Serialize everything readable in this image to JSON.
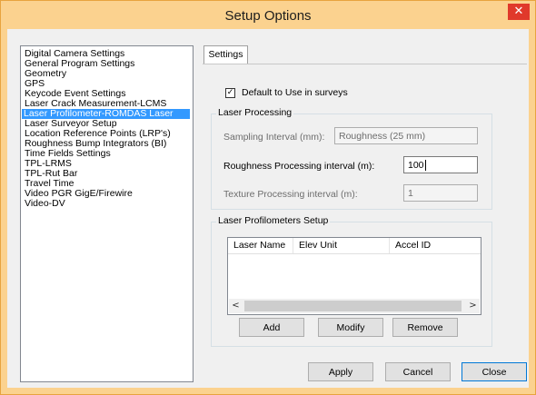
{
  "window": {
    "title": "Setup Options",
    "close_glyph": "✕"
  },
  "categories": [
    {
      "label": "Digital Camera Settings",
      "selected": false
    },
    {
      "label": "General Program Settings",
      "selected": false
    },
    {
      "label": "Geometry",
      "selected": false
    },
    {
      "label": "GPS",
      "selected": false
    },
    {
      "label": "Keycode Event Settings",
      "selected": false
    },
    {
      "label": "Laser Crack Measurement-LCMS",
      "selected": false
    },
    {
      "label": "Laser Profilometer-ROMDAS Laser",
      "selected": true
    },
    {
      "label": "Laser Surveyor Setup",
      "selected": false
    },
    {
      "label": "Location Reference Points (LRP's)",
      "selected": false
    },
    {
      "label": "Roughness Bump Integrators (BI)",
      "selected": false
    },
    {
      "label": "Time Fields Settings",
      "selected": false
    },
    {
      "label": "TPL-LRMS",
      "selected": false
    },
    {
      "label": "TPL-Rut Bar",
      "selected": false
    },
    {
      "label": "Travel Time",
      "selected": false
    },
    {
      "label": "Video PGR GigE/Firewire",
      "selected": false
    },
    {
      "label": "Video-DV",
      "selected": false
    }
  ],
  "tab": {
    "label": "Settings"
  },
  "default_checkbox": {
    "label": "Default to Use in surveys",
    "checked": true,
    "glyph": "✓"
  },
  "laser_processing": {
    "title": "Laser Processing",
    "sampling": {
      "label": "Sampling Interval (mm):",
      "value": "Roughness (25 mm)"
    },
    "roughness": {
      "label": "Roughness Processing interval (m):",
      "value": "100"
    },
    "texture": {
      "label": "Texture Processing interval (m):",
      "value": "1"
    }
  },
  "profilometers": {
    "title": "Laser Profilometers Setup",
    "columns": [
      "Laser Name",
      "Elev Unit",
      "Accel ID"
    ],
    "rows": [],
    "scroll_left": "<",
    "scroll_right": ">",
    "buttons": {
      "add": "Add",
      "modify": "Modify",
      "remove": "Remove"
    }
  },
  "footer": {
    "apply": "Apply",
    "cancel": "Cancel",
    "close": "Close"
  },
  "colors": {
    "title_bar": "#fbd28f",
    "selection": "#3399ff",
    "close_button": "#e0392b"
  }
}
